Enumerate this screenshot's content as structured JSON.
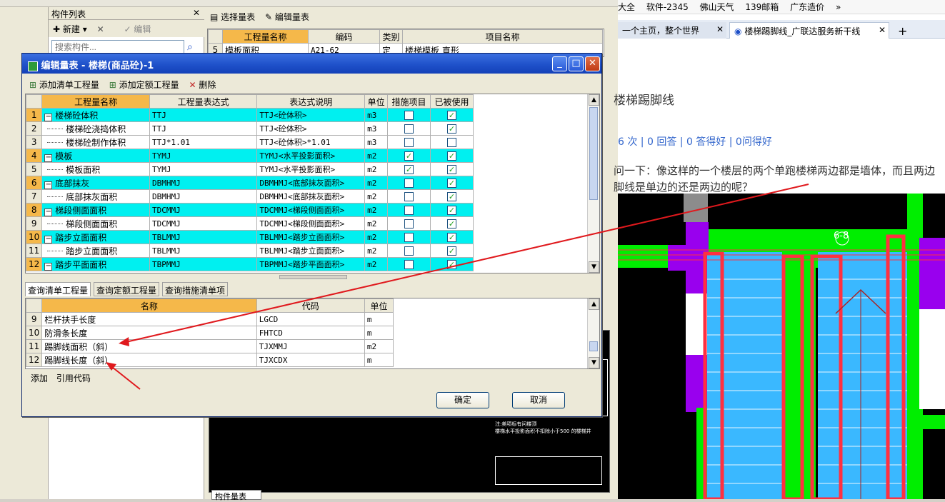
{
  "left_app": {
    "component_panel_title": "构件列表",
    "component_toolbar": {
      "new": "新建",
      "edit": "编辑"
    },
    "search_placeholder": "搜索构件...",
    "query_toolbar": {
      "select_table": "选择量表",
      "edit_table": "编辑量表"
    },
    "query_table": {
      "headers": [
        "工程量名称",
        "编码",
        "类别",
        "项目名称"
      ],
      "row": {
        "num": "5",
        "name": "模板面积",
        "code": "A21-62",
        "type": "定",
        "item": "楼梯模板 直形"
      }
    },
    "bottom_tab": "构件量表",
    "cad_note1": "注:美项标有问楼顶",
    "cad_note2": "楼梯水平投影面积不扣除小于500 的楼梯井"
  },
  "browser": {
    "bookmarks": [
      "大全",
      "软件-2345",
      "佛山天气",
      "139邮箱",
      "广东造价"
    ],
    "tabs": [
      "一个主页，整个世界",
      "楼梯踢脚线_广联达服务新干线"
    ],
    "page_title": "楼梯踢脚线",
    "stats": "6 次 | 0 回答 | 0 答得好 | 0问得好",
    "question_line1": "问一下：像这样的一个楼层的两个单跑楼梯两边都是墙体，而且两边",
    "question_line2": "脚线是单边的还是两边的呢？",
    "drawing_label": "6-8"
  },
  "dialog": {
    "title": "编辑量表 - 楼梯(商品砼)-1",
    "toolbar": {
      "add_list": "添加清单工程量",
      "add_quota": "添加定额工程量",
      "delete": "删除"
    },
    "grid_headers": [
      "工程量名称",
      "工程量表达式",
      "表达式说明",
      "单位",
      "措施项目",
      "已被使用"
    ],
    "rows": [
      {
        "n": "1",
        "name": "楼梯砼体积",
        "expr": "TTJ",
        "desc": "TTJ<砼体积>",
        "unit": "m3",
        "measure": false,
        "used": true,
        "parent": true
      },
      {
        "n": "2",
        "name": "楼梯砼浇捣体积",
        "expr": "TTJ",
        "desc": "TTJ<砼体积>",
        "unit": "m3",
        "measure": false,
        "used": true,
        "parent": false
      },
      {
        "n": "3",
        "name": "楼梯砼制作体积",
        "expr": "TTJ*1.01",
        "desc": "TTJ<砼体积>*1.01",
        "unit": "m3",
        "measure": false,
        "used": false,
        "parent": false
      },
      {
        "n": "4",
        "name": "模板",
        "expr": "TYMJ",
        "desc": "TYMJ<水平投影面积>",
        "unit": "m2",
        "measure": true,
        "used": true,
        "parent": true
      },
      {
        "n": "5",
        "name": "模板面积",
        "expr": "TYMJ",
        "desc": "TYMJ<水平投影面积>",
        "unit": "m2",
        "measure": true,
        "used": true,
        "parent": false
      },
      {
        "n": "6",
        "name": "底部抹灰",
        "expr": "DBMHMJ",
        "desc": "DBMHMJ<底部抹灰面积>",
        "unit": "m2",
        "measure": false,
        "used": true,
        "parent": true
      },
      {
        "n": "7",
        "name": "底部抹灰面积",
        "expr": "DBMHMJ",
        "desc": "DBMHMJ<底部抹灰面积>",
        "unit": "m2",
        "measure": false,
        "used": true,
        "parent": false
      },
      {
        "n": "8",
        "name": "梯段侧面面积",
        "expr": "TDCMMJ",
        "desc": "TDCMMJ<梯段侧面面积>",
        "unit": "m2",
        "measure": false,
        "used": true,
        "parent": true
      },
      {
        "n": "9",
        "name": "梯段侧面面积",
        "expr": "TDCMMJ",
        "desc": "TDCMMJ<梯段侧面面积>",
        "unit": "m2",
        "measure": false,
        "used": true,
        "parent": false
      },
      {
        "n": "10",
        "name": "踏步立面面积",
        "expr": "TBLMMJ",
        "desc": "TBLMMJ<踏步立面面积>",
        "unit": "m2",
        "measure": false,
        "used": true,
        "parent": true
      },
      {
        "n": "11",
        "name": "踏步立面面积",
        "expr": "TBLMMJ",
        "desc": "TBLMMJ<踏步立面面积>",
        "unit": "m2",
        "measure": false,
        "used": true,
        "parent": false
      },
      {
        "n": "12",
        "name": "踏步平面面积",
        "expr": "TBPMMJ",
        "desc": "TBPMMJ<踏步平面面积>",
        "unit": "m2",
        "measure": false,
        "used": true,
        "parent": true
      }
    ],
    "query_tabs": [
      "查询清单工程量",
      "查询定额工程量",
      "查询措施清单项"
    ],
    "query_headers": [
      "名称",
      "代码",
      "单位"
    ],
    "query_rows": [
      {
        "n": "9",
        "name": "栏杆扶手长度",
        "code": "LGCD",
        "unit": "m"
      },
      {
        "n": "10",
        "name": "防滑条长度",
        "code": "FHTCD",
        "unit": "m"
      },
      {
        "n": "11",
        "name": "踢脚线面积（斜）",
        "code": "TJXMMJ",
        "unit": "m2"
      },
      {
        "n": "12",
        "name": "踢脚线长度（斜）",
        "code": "TJXCDX",
        "unit": "m"
      }
    ],
    "bottom_buttons": {
      "add": "添加",
      "ref": "引用代码"
    },
    "ok": "确定",
    "cancel": "取消"
  },
  "colors": {
    "accent": "#00f0f0",
    "header": "#f5b84a",
    "title_bar": "#1d4fc8",
    "arrow": "#e0191d"
  }
}
